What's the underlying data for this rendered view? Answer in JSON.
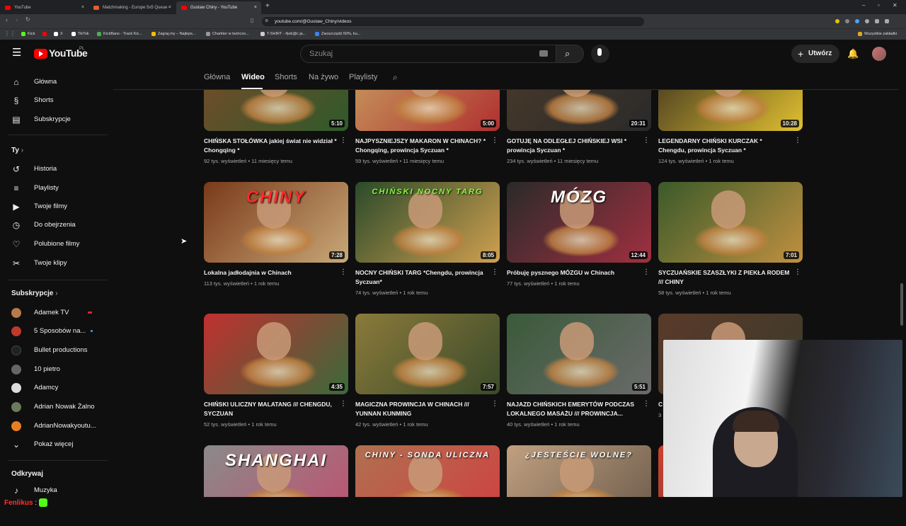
{
  "browser": {
    "tabs": [
      {
        "label": "YouTube",
        "color": "#ff0000"
      },
      {
        "label": "Matchmaking - Europe 5v5 Queue -",
        "color": "#e85d2a"
      },
      {
        "label": "Gustaw Chiny - YouTube",
        "color": "#ff0000"
      }
    ],
    "url": "youtube.com/@Gustaw_Chiny/videos",
    "bookmarks": [
      {
        "label": "Kick",
        "color": "#53fc18"
      },
      {
        "label": "X",
        "color": "#ffffff"
      },
      {
        "label": "TikTok",
        "color": "#ffffff"
      },
      {
        "label": "KickBans - Track Kic...",
        "color": "#4caf50"
      },
      {
        "label": "Zagraj.my – Najleps...",
        "color": "#f5c000"
      },
      {
        "label": "Charkter w twórczo...",
        "color": "#999999"
      },
      {
        "label": "T-SHIRT - #jeb@c ja...",
        "color": "#cccccc"
      },
      {
        "label": "Zaoszczędź 60%, ku...",
        "color": "#3b82f6"
      }
    ],
    "all_bookmarks": "Wszystkie zakładki"
  },
  "header": {
    "logo": "YouTube",
    "country": "PL",
    "search_placeholder": "Szukaj",
    "create_label": "Utwórz"
  },
  "sidebar": {
    "main": [
      {
        "label": "Główna",
        "icon": "home-icon",
        "glyph": "⌂"
      },
      {
        "label": "Shorts",
        "icon": "shorts-icon",
        "glyph": "§"
      },
      {
        "label": "Subskrypcje",
        "icon": "subscriptions-icon",
        "glyph": "▤"
      }
    ],
    "you_title": "Ty",
    "you": [
      {
        "label": "Historia",
        "icon": "history-icon",
        "glyph": "↺"
      },
      {
        "label": "Playlisty",
        "icon": "playlists-icon",
        "glyph": "≡"
      },
      {
        "label": "Twoje filmy",
        "icon": "your-videos-icon",
        "glyph": "▶"
      },
      {
        "label": "Do obejrzenia",
        "icon": "watch-later-icon",
        "glyph": "◷"
      },
      {
        "label": "Polubione filmy",
        "icon": "liked-icon",
        "glyph": "👍"
      },
      {
        "label": "Twoje klipy",
        "icon": "clips-icon",
        "glyph": "✂"
      }
    ],
    "subs_title": "Subskrypcje",
    "subs": [
      {
        "label": "Adamek TV",
        "color": "#b87a4b"
      },
      {
        "label": "5 Sposobów na...",
        "color": "#c0392b"
      },
      {
        "label": "Bullet productions",
        "color": "#222222"
      },
      {
        "label": "10 pietro",
        "color": "#666666"
      },
      {
        "label": "Adamcy",
        "color": "#dddddd"
      },
      {
        "label": "Adrian Nowak Żalno",
        "color": "#6a7a5a"
      },
      {
        "label": "AdrianNowakyoutu...",
        "color": "#e67e22"
      }
    ],
    "show_more": "Pokaż więcej",
    "explore_title": "Odkrywaj",
    "explore": [
      {
        "label": "Muzyka",
        "icon": "music-icon",
        "glyph": "♪"
      }
    ]
  },
  "channel_tabs": [
    "Główna",
    "Wideo",
    "Shorts",
    "Na żywo",
    "Playlisty"
  ],
  "videos": [
    {
      "title": "CHIŃSKA STOŁÓWKA jakiej świat nie widział * Chongqing *",
      "meta": "92 tys. wyświetleń • 11 miesięcy temu",
      "duration": "5:10",
      "c1": "#7a4a2a",
      "c2": "#2f5a2a"
    },
    {
      "title": "NAJPYSZNIEJSZY MAKARON W CHINACH? * Chongqing, prowincja Syczuan *",
      "meta": "59 tys. wyświetleń • 11 miesięcy temu",
      "duration": "5:00",
      "c1": "#c8a060",
      "c2": "#b03030"
    },
    {
      "title": "GOTUJĘ NA ODLEGŁEJ CHIŃSKIEJ WSI * prowincja Syczuan *",
      "meta": "234 tys. wyświetleń • 11 miesięcy temu",
      "duration": "20:31",
      "c1": "#4a3a2a",
      "c2": "#2a2a2a"
    },
    {
      "title": "LEGENDARNY CHIŃSKI KURCZAK * Chengdu, prowincja Syczuan *",
      "meta": "124 tys. wyświetleń • 1 rok temu",
      "duration": "10:28",
      "c1": "#3a3020",
      "c2": "#e0c030"
    },
    {
      "title": "Lokalna jadłodajnia w Chinach",
      "meta": "113 tys. wyświetleń • 1 rok temu",
      "duration": "7:28",
      "c1": "#7a3a1a",
      "c2": "#c8a878",
      "overlay": "CHINY",
      "overlay_color": "#ff2a2a"
    },
    {
      "title": "NOCNY CHIŃSKI TARG *Chengdu, prowincja Syczuan*",
      "meta": "74 tys. wyświetleń • 1 rok temu",
      "duration": "8:05",
      "c1": "#2a4a2a",
      "c2": "#d0a050",
      "overlay": "CHIŃSKI NOCNY TARG",
      "overlay_color": "#7dff3a"
    },
    {
      "title": "Próbuję pysznego MÓZGU w Chinach",
      "meta": "77 tys. wyświetleń • 1 rok temu",
      "duration": "12:44",
      "c1": "#2a2a2a",
      "c2": "#a03040",
      "overlay": "MÓZG",
      "overlay_color": "#ffffff"
    },
    {
      "title": "SYCZUAŃSKIE SZASZŁYKI Z PIEKŁA RODEM /// CHINY",
      "meta": "58 tys. wyświetleń • 1 rok temu",
      "duration": "7:01",
      "c1": "#3a5a2a",
      "c2": "#c09040"
    },
    {
      "title": "CHIŃSKI ULICZNY MALATANG /// CHENGDU, SYCZUAN",
      "meta": "52 tys. wyświetleń • 1 rok temu",
      "duration": "4:35",
      "c1": "#c03030",
      "c2": "#3a6a3a"
    },
    {
      "title": "MAGICZNA PROWINCJA W CHINACH /// YUNNAN KUNMING",
      "meta": "42 tys. wyświetleń • 1 rok temu",
      "duration": "7:57",
      "c1": "#8a7a3a",
      "c2": "#3a4a2a"
    },
    {
      "title": "NAJAZD CHIŃSKICH EMERYTÓW PODCZAS LOKALNEGO MASAŻU /// PROWINCJA...",
      "meta": "40 tys. wyświetleń • 1 rok temu",
      "duration": "5:51",
      "c1": "#3a5a3a",
      "c2": "#6a6a6a"
    },
    {
      "title": "C",
      "meta": "3",
      "duration": "",
      "c1": "#5a3a2a",
      "c2": "#3a3a2a"
    },
    {
      "title": "",
      "meta": "",
      "duration": "",
      "c1": "#8a8a8a",
      "c2": "#c05070",
      "overlay": "SHANGHAI",
      "overlay_color": "#ffffff"
    },
    {
      "title": "",
      "meta": "",
      "duration": "",
      "c1": "#b07050",
      "c2": "#d04040",
      "overlay": "CHINY - SONDA ULICZNA",
      "overlay_color": "#ffffff"
    },
    {
      "title": "",
      "meta": "",
      "duration": "",
      "c1": "#c0a080",
      "c2": "#6a5a4a",
      "overlay": "¿JESTEŚCIE WOLNE?",
      "overlay_color": "#ffffff"
    },
    {
      "title": "",
      "meta": "",
      "duration": "",
      "c1": "#d04030",
      "c2": "#3a3a3a"
    }
  ],
  "chat": {
    "user": "Fenlikus",
    "sep": ":",
    "user_color": "#ff3333"
  }
}
